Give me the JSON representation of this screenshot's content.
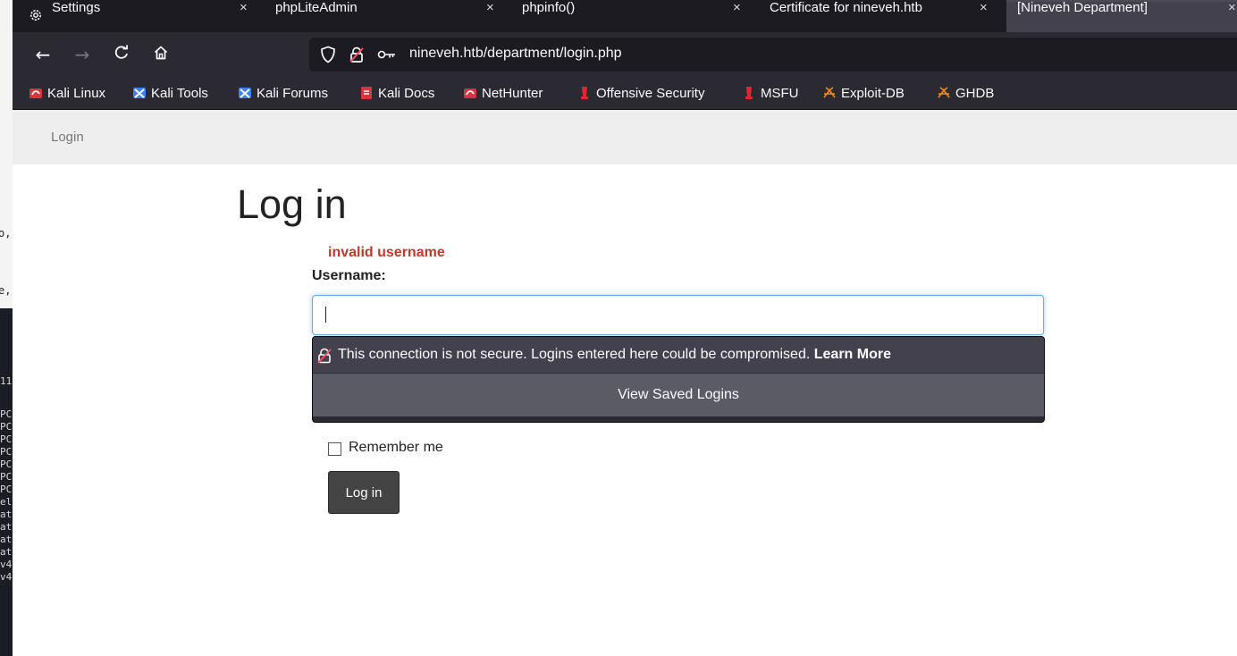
{
  "background_terminal": {
    "fragment_1": "o,",
    "fragment_2": "e,",
    "lines": [
      "11",
      "",
      "PC",
      "PC",
      "PC",
      "PC",
      "PC",
      "PC",
      "PC",
      "el",
      "at",
      "at",
      "at",
      "at",
      "v4",
      "v4"
    ]
  },
  "tabs": [
    {
      "label": "Settings",
      "icon": "gear-icon",
      "close": "×"
    },
    {
      "label": "phpLiteAdmin",
      "close": "×"
    },
    {
      "label": "phpinfo()",
      "close": "×"
    },
    {
      "label": "Certificate for nineveh.htb",
      "close": "×"
    },
    {
      "label": "[Nineveh Department]",
      "close": "×",
      "active": true
    }
  ],
  "navbar": {
    "back": "←",
    "forward": "→",
    "reload": "C",
    "home": "⌂",
    "url": "nineveh.htb/department/login.php"
  },
  "bookmarks": [
    {
      "label": "Kali Linux",
      "icon": "kali-icon"
    },
    {
      "label": "Kali Tools",
      "icon": "kali-tools-icon"
    },
    {
      "label": "Kali Forums",
      "icon": "kali-forums-icon"
    },
    {
      "label": "Kali Docs",
      "icon": "kali-docs-icon"
    },
    {
      "label": "NetHunter",
      "icon": "nethunter-icon"
    },
    {
      "label": "Offensive Security",
      "icon": "offsec-icon"
    },
    {
      "label": "MSFU",
      "icon": "msfu-icon"
    },
    {
      "label": "Exploit-DB",
      "icon": "exploit-db-icon"
    },
    {
      "label": "GHDB",
      "icon": "ghdb-icon"
    }
  ],
  "page": {
    "nav_link": "Login",
    "heading": "Log in",
    "error": "invalid username",
    "username_label": "Username:",
    "username_value": "",
    "insecure_warning": "This connection is not secure. Logins entered here could be compromised. ",
    "learn_more": "Learn More",
    "view_saved_logins": "View Saved Logins",
    "remember_me": "Remember me",
    "login_button": "Log in"
  },
  "colors": {
    "tabbar_bg": "#1c1b22",
    "toolbar_bg": "#2b2a33",
    "error_text": "#c0392b",
    "input_focus": "#66afe9",
    "button_bg": "#444444"
  }
}
